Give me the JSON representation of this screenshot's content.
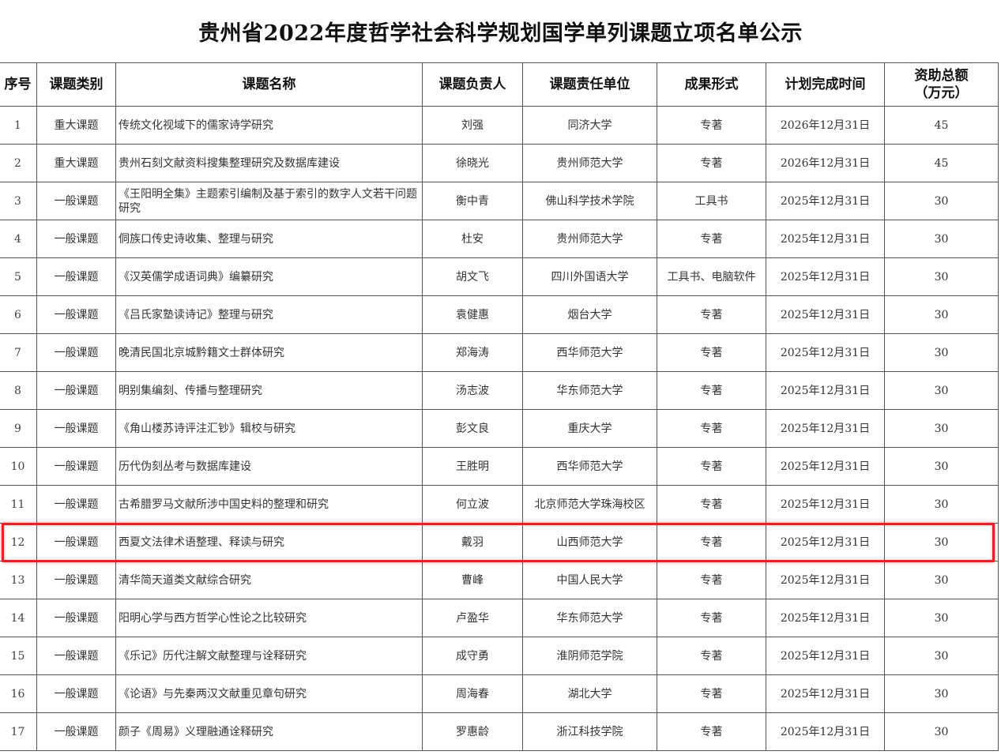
{
  "title": "贵州省2022年度哲学社会科学规划国学单列课题立项名单公示",
  "headers": {
    "seq": "序号",
    "category": "课题类别",
    "name": "课题名称",
    "leader": "课题负责人",
    "unit": "课题责任单位",
    "form": "成果形式",
    "deadline": "计划完成时间",
    "funding_line1": "资助总额",
    "funding_line2": "（万元）"
  },
  "rows": [
    {
      "seq": "1",
      "category": "重大课题",
      "name": "传统文化视域下的儒家诗学研究",
      "leader": "刘强",
      "unit": "同济大学",
      "form": "专著",
      "deadline": "2026年12月31日",
      "funding": "45"
    },
    {
      "seq": "2",
      "category": "重大课题",
      "name": "贵州石刻文献资料搜集整理研究及数据库建设",
      "leader": "徐晓光",
      "unit": "贵州师范大学",
      "form": "专著",
      "deadline": "2026年12月31日",
      "funding": "45"
    },
    {
      "seq": "3",
      "category": "一般课题",
      "name": "《王阳明全集》主题索引编制及基于索引的数字人文若干问题研究",
      "leader": "衡中青",
      "unit": "佛山科学技术学院",
      "form": "工具书",
      "deadline": "2025年12月31日",
      "funding": "30"
    },
    {
      "seq": "4",
      "category": "一般课题",
      "name": "侗族口传史诗收集、整理与研究",
      "leader": "杜安",
      "unit": "贵州师范大学",
      "form": "专著",
      "deadline": "2025年12月31日",
      "funding": "30"
    },
    {
      "seq": "5",
      "category": "一般课题",
      "name": "《汉英儒学成语词典》编纂研究",
      "leader": "胡文飞",
      "unit": "四川外国语大学",
      "form": "工具书、电脑软件",
      "deadline": "2025年12月31日",
      "funding": "30"
    },
    {
      "seq": "6",
      "category": "一般课题",
      "name": "《吕氏家塾读诗记》整理与研究",
      "leader": "袁健惠",
      "unit": "烟台大学",
      "form": "专著",
      "deadline": "2025年12月31日",
      "funding": "30"
    },
    {
      "seq": "7",
      "category": "一般课题",
      "name": "晚清民国北京城黔籍文士群体研究",
      "leader": "郑海涛",
      "unit": "西华师范大学",
      "form": "专著",
      "deadline": "2025年12月31日",
      "funding": "30"
    },
    {
      "seq": "8",
      "category": "一般课题",
      "name": "明别集编刻、传播与整理研究",
      "leader": "汤志波",
      "unit": "华东师范大学",
      "form": "专著",
      "deadline": "2025年12月31日",
      "funding": "30"
    },
    {
      "seq": "9",
      "category": "一般课题",
      "name": "《角山楼苏诗评注汇钞》辑校与研究",
      "leader": "彭文良",
      "unit": "重庆大学",
      "form": "专著",
      "deadline": "2025年12月31日",
      "funding": "30"
    },
    {
      "seq": "10",
      "category": "一般课题",
      "name": "历代伪刻丛考与数据库建设",
      "leader": "王胜明",
      "unit": "西华师范大学",
      "form": "专著",
      "deadline": "2025年12月31日",
      "funding": "30"
    },
    {
      "seq": "11",
      "category": "一般课题",
      "name": "古希腊罗马文献所涉中国史料的整理和研究",
      "leader": "何立波",
      "unit": "北京师范大学珠海校区",
      "form": "专著",
      "deadline": "2025年12月31日",
      "funding": "30"
    },
    {
      "seq": "12",
      "category": "一般课题",
      "name": "西夏文法律术语整理、释读与研究",
      "leader": "戴羽",
      "unit": "山西师范大学",
      "form": "专著",
      "deadline": "2025年12月31日",
      "funding": "30"
    },
    {
      "seq": "13",
      "category": "一般课题",
      "name": "清华简天道类文献综合研究",
      "leader": "曹峰",
      "unit": "中国人民大学",
      "form": "专著",
      "deadline": "2025年12月31日",
      "funding": "30"
    },
    {
      "seq": "14",
      "category": "一般课题",
      "name": "阳明心学与西方哲学心性论之比较研究",
      "leader": "卢盈华",
      "unit": "华东师范大学",
      "form": "专著",
      "deadline": "2025年12月31日",
      "funding": "30"
    },
    {
      "seq": "15",
      "category": "一般课题",
      "name": "《乐记》历代注解文献整理与诠释研究",
      "leader": "成守勇",
      "unit": "淮阴师范学院",
      "form": "专著",
      "deadline": "2025年12月31日",
      "funding": "30"
    },
    {
      "seq": "16",
      "category": "一般课题",
      "name": "《论语》与先秦两汉文献重见章句研究",
      "leader": "周海春",
      "unit": "湖北大学",
      "form": "专著",
      "deadline": "2025年12月31日",
      "funding": "30"
    },
    {
      "seq": "17",
      "category": "一般课题",
      "name": "颜子《周易》义理融通诠释研究",
      "leader": "罗惠龄",
      "unit": "浙江科技学院",
      "form": "专著",
      "deadline": "2025年12月31日",
      "funding": "30"
    }
  ],
  "highlighted_row": "12",
  "colors": {
    "highlight": "#e8202a",
    "border": "#555555"
  }
}
